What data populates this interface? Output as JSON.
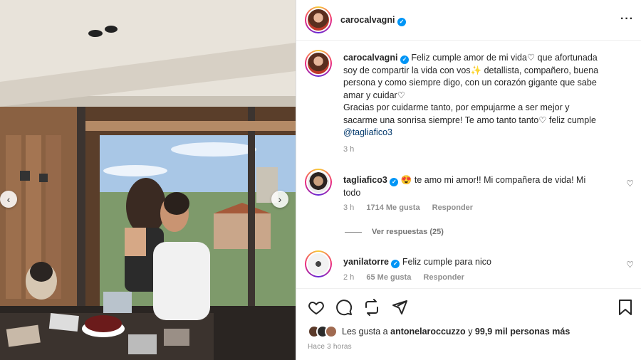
{
  "post": {
    "author": "carocalvagni",
    "caption_lines": [
      "Feliz cumple amor de mi vida♡ que afortunada",
      "soy de compartir la vida con vos✨ detallista, compañero, buena",
      "persona y como siempre digo, con un corazón gigante que sabe",
      "amar y cuidar♡",
      "Gracias por cuidarme tanto, por empujarme a ser mejor y",
      "sacarme una sonrisa siempre! Te amo tanto tanto♡ feliz cumple"
    ],
    "caption_mention": "@tagliafico3",
    "caption_time": "3 h"
  },
  "comments": [
    {
      "username": "tagliafico3",
      "emoji": "😍",
      "text_line1": "te amo mi amor!! Mi compañera de vida! Mi",
      "text_line2": "todo",
      "time": "3 h",
      "likes": "1714 Me gusta",
      "reply": "Responder",
      "view_replies": "Ver respuestas (25)"
    },
    {
      "username": "yanilatorre",
      "text": "Feliz cumple para nico",
      "time": "2 h",
      "likes": "65 Me gusta",
      "reply": "Responder"
    }
  ],
  "likes": {
    "prefix": "Les gusta a",
    "liker": "antonelaroccuzzo",
    "connector": "y",
    "rest": "99,9 mil personas más"
  },
  "posted_time": "Hace 3 horas",
  "icons": {
    "more": "more-options-icon",
    "like": "heart-icon",
    "comment": "comment-icon",
    "share": "share-icon",
    "save": "bookmark-icon",
    "prev": "chevron-left-icon",
    "next": "chevron-right-icon"
  },
  "colors": {
    "verified": "#0095f6",
    "mention": "#00376b",
    "muted": "#8e8e8e"
  }
}
